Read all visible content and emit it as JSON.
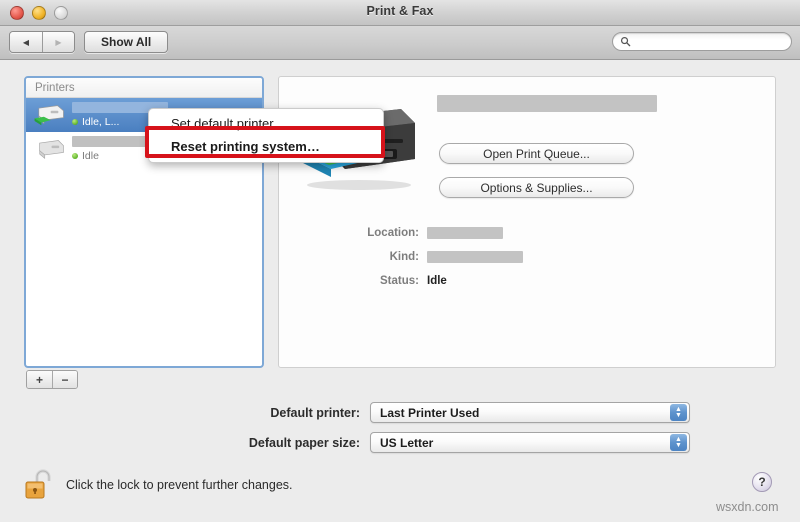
{
  "window": {
    "title": "Print & Fax",
    "controls": {
      "close": "close-button",
      "minimize": "minimize-button",
      "zoom": "zoom-button"
    }
  },
  "toolbar": {
    "back_label": "◀",
    "forward_label": "▶",
    "show_all_label": "Show All",
    "search_placeholder": "",
    "search_value": ""
  },
  "printer_list": {
    "header": "Printers",
    "items": [
      {
        "name_redacted": true,
        "status": "Idle, L...",
        "selected": true,
        "icon": "color-printer-icon"
      },
      {
        "name_redacted": true,
        "status": "Idle",
        "selected": false,
        "icon": "gray-printer-icon"
      }
    ],
    "add_label": "+",
    "remove_label": "−"
  },
  "context_menu": {
    "items": [
      {
        "label": "Set default printer",
        "highlighted": false
      },
      {
        "label": "Reset printing system…",
        "highlighted": true
      }
    ],
    "highlight_color": "#d6121a"
  },
  "detail": {
    "name_redacted": true,
    "buttons": {
      "print_queue": "Open Print Queue...",
      "options_supplies": "Options & Supplies..."
    },
    "info": [
      {
        "label": "Location:",
        "value": "",
        "redacted": true
      },
      {
        "label": "Kind:",
        "value": "",
        "redacted": true
      },
      {
        "label": "Status:",
        "value": "Idle",
        "redacted": false
      }
    ]
  },
  "defaults": {
    "printer_label": "Default printer:",
    "printer_value": "Last Printer Used",
    "paper_label": "Default paper size:",
    "paper_value": "US Letter"
  },
  "footer": {
    "lock_text": "Click the lock to prevent further changes.",
    "lock_icon": "open-padlock-icon",
    "help_label": "?",
    "watermark": "wsxdn.com"
  }
}
